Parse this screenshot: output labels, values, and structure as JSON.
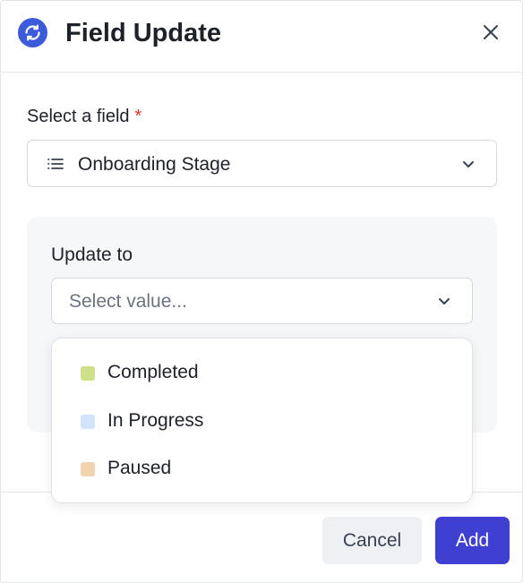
{
  "dialog": {
    "title": "Field Update",
    "header_icon": "sync-icon",
    "close_icon": "close-icon"
  },
  "field": {
    "label": "Select a field",
    "required_mark": "*",
    "selected_value": "Onboarding Stage",
    "value_icon": "list-icon",
    "dropdown_icon": "chevron-down-icon"
  },
  "update": {
    "label": "Update to",
    "placeholder": "Select value...",
    "dropdown_icon": "chevron-down-icon",
    "options": [
      {
        "label": "Completed",
        "color": "#cfe08a"
      },
      {
        "label": "In Progress",
        "color": "#d3e3fb"
      },
      {
        "label": "Paused",
        "color": "#f1d3b2"
      }
    ]
  },
  "footer": {
    "cancel_label": "Cancel",
    "add_label": "Add"
  },
  "colors": {
    "accent": "#3f3fd1",
    "header_icon_bg": "#3b5bdb",
    "required": "#e03131"
  }
}
